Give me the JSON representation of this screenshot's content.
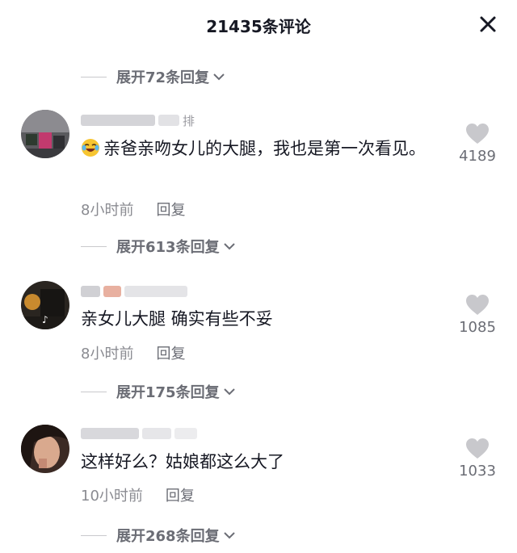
{
  "header": {
    "title": "21435条评论"
  },
  "expanders": [
    {
      "label": "展开72条回复"
    },
    {
      "label": "展开613条回复"
    },
    {
      "label": "展开175条回复"
    },
    {
      "label": "展开268条回复"
    }
  ],
  "comments": [
    {
      "username_visible": "排",
      "text": "亲爸亲吻女儿的大腿，我也是第一次看见。",
      "time": "8小时前",
      "reply": "回复",
      "likes": "4189",
      "emoji": "laughing-tears-icon"
    },
    {
      "username_visible": "",
      "text": "亲女儿大腿 确实有些不妥",
      "time": "8小时前",
      "reply": "回复",
      "likes": "1085"
    },
    {
      "username_visible": "",
      "text": "这样好么？姑娘都这么大了",
      "time": "10小时前",
      "reply": "回复",
      "likes": "1033"
    }
  ],
  "colors": {
    "text": "#161823",
    "muted": "#8a8b91",
    "heart": "#c8c8cc"
  }
}
